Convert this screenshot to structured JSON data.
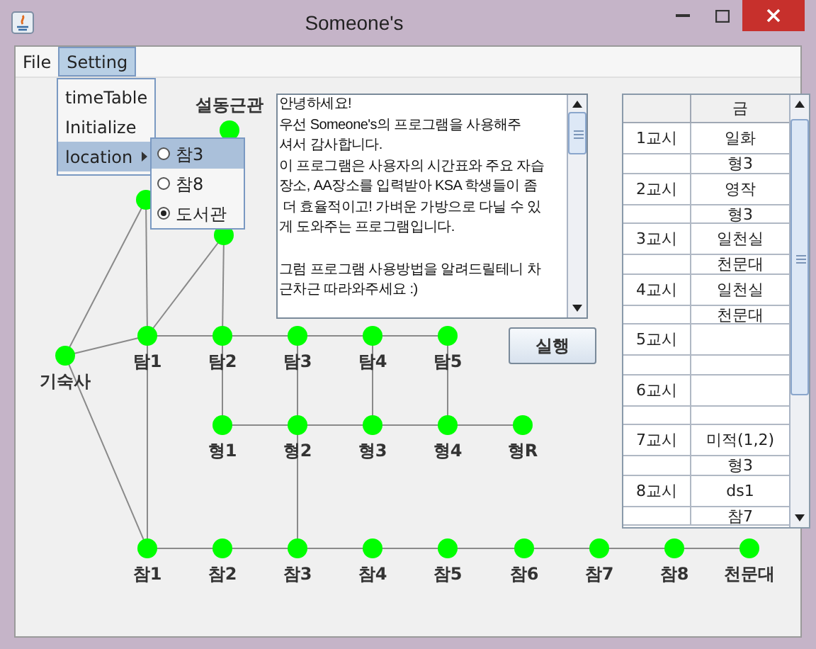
{
  "window": {
    "title": "Someone's"
  },
  "menu_bar": [
    {
      "label": "File",
      "selected": false
    },
    {
      "label": "Setting",
      "selected": true
    }
  ],
  "menu": {
    "items": [
      {
        "label": "timeTable",
        "kind": "item",
        "selected": false
      },
      {
        "label": "Initialize",
        "kind": "item",
        "selected": false
      },
      {
        "label": "location",
        "kind": "submenu",
        "selected": true
      }
    ]
  },
  "submenu": {
    "items": [
      {
        "label": "참3",
        "selected": true,
        "checked": false
      },
      {
        "label": "참8",
        "selected": false,
        "checked": false
      },
      {
        "label": "도서관",
        "selected": false,
        "checked": true
      }
    ]
  },
  "graph": {
    "nodes": [
      {
        "label": "설동근관"
      },
      {
        "label": "기숙사"
      },
      {
        "label": "탐1"
      },
      {
        "label": "탐2"
      },
      {
        "label": "탐3"
      },
      {
        "label": "탐4"
      },
      {
        "label": "탐5"
      },
      {
        "label": "형1"
      },
      {
        "label": "형2"
      },
      {
        "label": "형3"
      },
      {
        "label": "형4"
      },
      {
        "label": "형R"
      },
      {
        "label": "참1"
      },
      {
        "label": "참2"
      },
      {
        "label": "참3"
      },
      {
        "label": "참4"
      },
      {
        "label": "참5"
      },
      {
        "label": "참6"
      },
      {
        "label": "참7"
      },
      {
        "label": "참8"
      },
      {
        "label": "천문대"
      }
    ]
  },
  "text_area": {
    "paragraphs": [
      [
        "안녕하세요!",
        "우선 Someone's의 프로그램을 사용해주",
        "셔서 감사합니다.",
        "이 프로그램은 사용자의 시간표와 주요 자습",
        "장소, AA장소를 입력받아 KSA 학생들이 좀",
        " 더 효율적이고! 가벼운 가방으로 다닐 수 있",
        "게 도와주는 프로그램입니다."
      ],
      [
        "그럼 프로그램 사용방법을 알려드릴테니 차",
        "근차근 따라와주세요 :)"
      ]
    ]
  },
  "run_button": {
    "label": "실행"
  },
  "table": {
    "columns": [
      {
        "label": "금"
      }
    ],
    "rows": [
      {
        "period": "1교시",
        "cells": [
          "일화",
          "형3"
        ]
      },
      {
        "period": "2교시",
        "cells": [
          "영작",
          "형3"
        ]
      },
      {
        "period": "3교시",
        "cells": [
          "일천실",
          "천문대"
        ]
      },
      {
        "period": "4교시",
        "cells": [
          "일천실",
          "천문대"
        ]
      },
      {
        "period": "5교시",
        "cells": []
      },
      {
        "period": "6교시",
        "cells": []
      },
      {
        "period": "7교시",
        "cells": [
          "미적(1,2)",
          "형3"
        ]
      },
      {
        "period": "8교시",
        "cells": [
          "ds1",
          "참7"
        ]
      }
    ]
  }
}
